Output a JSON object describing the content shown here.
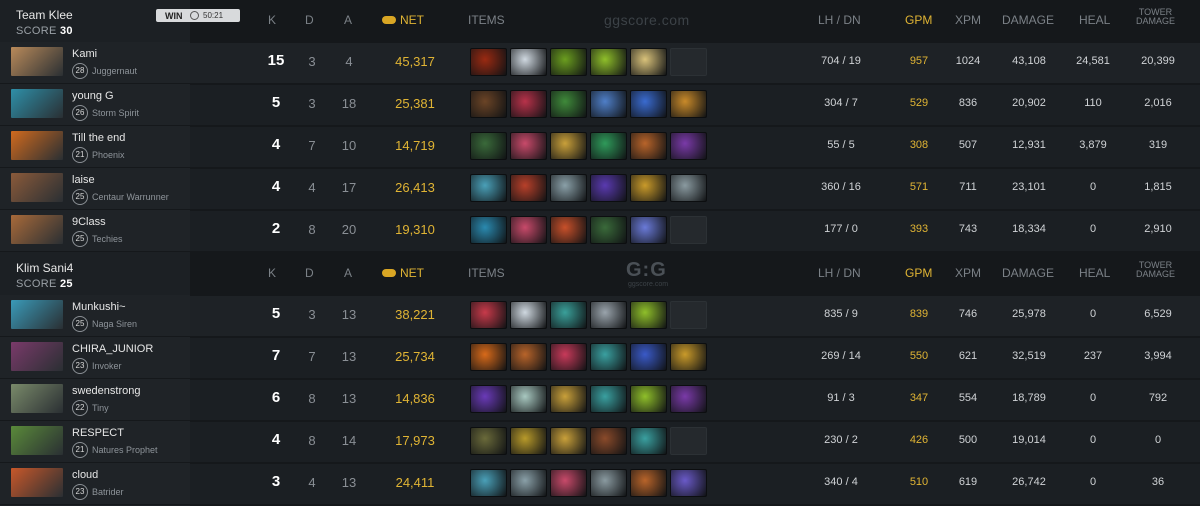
{
  "columns": {
    "k": "K",
    "d": "D",
    "a": "A",
    "net": "NET",
    "items": "ITEMS",
    "lhdn": "LH / DN",
    "gpm": "GPM",
    "xpm": "XPM",
    "damage": "DAMAGE",
    "heal": "HEAL",
    "tower_damage_line1": "TOWER",
    "tower_damage_line2": "DAMAGE"
  },
  "watermark_text": "ggscore.com",
  "watermark_logo": "G:G",
  "teams": [
    {
      "name": "Team Klee",
      "score_label": "SCORE",
      "score": "30",
      "result_badge": "WIN",
      "match_time": "50:21",
      "players": [
        {
          "name": "Kami",
          "level": "28",
          "hero": "Juggernaut",
          "k": "15",
          "d": "3",
          "a": "4",
          "net": "45,317",
          "lh_dn": "704  /  19",
          "gpm": "957",
          "xpm": "1024",
          "damage": "43,108",
          "heal": "24,581",
          "tower_damage": "20,399",
          "portrait_color": "#b98a5a",
          "items": [
            "#9a2a12",
            "#cfd8e0",
            "#6b9e1f",
            "#8fbf2a",
            "#d9c27a",
            ""
          ]
        },
        {
          "name": "young G",
          "level": "26",
          "hero": "Storm Spirit",
          "k": "5",
          "d": "3",
          "a": "18",
          "net": "25,381",
          "lh_dn": "304  /  7",
          "gpm": "529",
          "xpm": "836",
          "damage": "20,902",
          "heal": "110",
          "tower_damage": "2,016",
          "portrait_color": "#2e8fa8",
          "items": [
            "#6b4426",
            "#b8324a",
            "#3f8a3a",
            "#4f7fc8",
            "#3a6bd0",
            "#c98a2a"
          ]
        },
        {
          "name": "Till the end",
          "level": "21",
          "hero": "Phoenix",
          "k": "4",
          "d": "7",
          "a": "10",
          "net": "14,719",
          "lh_dn": "55  /  5",
          "gpm": "308",
          "xpm": "507",
          "damage": "12,931",
          "heal": "3,879",
          "tower_damage": "319",
          "portrait_color": "#d06a1e",
          "items": [
            "#3a6a3a",
            "#c84a6a",
            "#c9a03a",
            "#2f9a5a",
            "#b8642a",
            "#7a3aa8"
          ]
        },
        {
          "name": "laise",
          "level": "25",
          "hero": "Centaur Warrunner",
          "k": "4",
          "d": "4",
          "a": "17",
          "net": "26,413",
          "lh_dn": "360  /  16",
          "gpm": "571",
          "xpm": "711",
          "damage": "23,101",
          "heal": "0",
          "tower_damage": "1,815",
          "portrait_color": "#8a5a3a",
          "items": [
            "#4aa0b8",
            "#b8402a",
            "#8aa0a8",
            "#5a3ab0",
            "#c99a2a",
            "#8a9aa0"
          ]
        },
        {
          "name": "9Class",
          "level": "25",
          "hero": "Techies",
          "k": "2",
          "d": "8",
          "a": "20",
          "net": "19,310",
          "lh_dn": "177  /  0",
          "gpm": "393",
          "xpm": "743",
          "damage": "18,334",
          "heal": "0",
          "tower_damage": "2,910",
          "portrait_color": "#a86a3a",
          "items": [
            "#2a8ab0",
            "#c84a6a",
            "#c8502a",
            "#3a6a3a",
            "#6a7ad8",
            ""
          ]
        }
      ]
    },
    {
      "name": "Klim Sani4",
      "score_label": "SCORE",
      "score": "25",
      "players": [
        {
          "name": "Munkushi~",
          "level": "25",
          "hero": "Naga Siren",
          "k": "5",
          "d": "3",
          "a": "13",
          "net": "38,221",
          "lh_dn": "835  /  9",
          "gpm": "839",
          "xpm": "746",
          "damage": "25,978",
          "heal": "0",
          "tower_damage": "6,529",
          "portrait_color": "#3a9ab8",
          "items": [
            "#c83a4a",
            "#cfd8e0",
            "#3aa09a",
            "#9aa4ac",
            "#8fbf2a",
            ""
          ]
        },
        {
          "name": "CHIRA_JUNIOR",
          "level": "23",
          "hero": "Invoker",
          "k": "7",
          "d": "7",
          "a": "13",
          "net": "25,734",
          "lh_dn": "269  /  14",
          "gpm": "550",
          "xpm": "621",
          "damage": "32,519",
          "heal": "237",
          "tower_damage": "3,994",
          "portrait_color": "#7a3a6a",
          "items": [
            "#d86a1a",
            "#b8642a",
            "#c83a5a",
            "#3aa0a0",
            "#3a5ac8",
            "#c99a2a"
          ]
        },
        {
          "name": "swedenstrong",
          "level": "22",
          "hero": "Tiny",
          "k": "6",
          "d": "8",
          "a": "13",
          "net": "14,836",
          "lh_dn": "91  /  3",
          "gpm": "347",
          "xpm": "554",
          "damage": "18,789",
          "heal": "0",
          "tower_damage": "792",
          "portrait_color": "#7a8a6a",
          "items": [
            "#6a3ab8",
            "#a8c8c0",
            "#c9a03a",
            "#3aa0a0",
            "#8fbf2a",
            "#7a3aa8"
          ]
        },
        {
          "name": "RESPECT",
          "level": "21",
          "hero": "Natures Prophet",
          "k": "4",
          "d": "8",
          "a": "14",
          "net": "17,973",
          "lh_dn": "230  /  2",
          "gpm": "426",
          "xpm": "500",
          "damage": "19,014",
          "heal": "0",
          "tower_damage": "0",
          "portrait_color": "#5a8a3a",
          "items": [
            "#6a6a3a",
            "#b89a2a",
            "#c9a03a",
            "#8a4a2a",
            "#3aa0a0",
            ""
          ]
        },
        {
          "name": "cloud",
          "level": "23",
          "hero": "Batrider",
          "k": "3",
          "d": "4",
          "a": "13",
          "net": "24,411",
          "lh_dn": "340  /  4",
          "gpm": "510",
          "xpm": "619",
          "damage": "26,742",
          "heal": "0",
          "tower_damage": "36",
          "portrait_color": "#c8582a",
          "items": [
            "#4aa0b8",
            "#8aa0a8",
            "#c84a6a",
            "#8a9aa0",
            "#b8642a",
            "#6a5ac8"
          ]
        }
      ]
    }
  ]
}
